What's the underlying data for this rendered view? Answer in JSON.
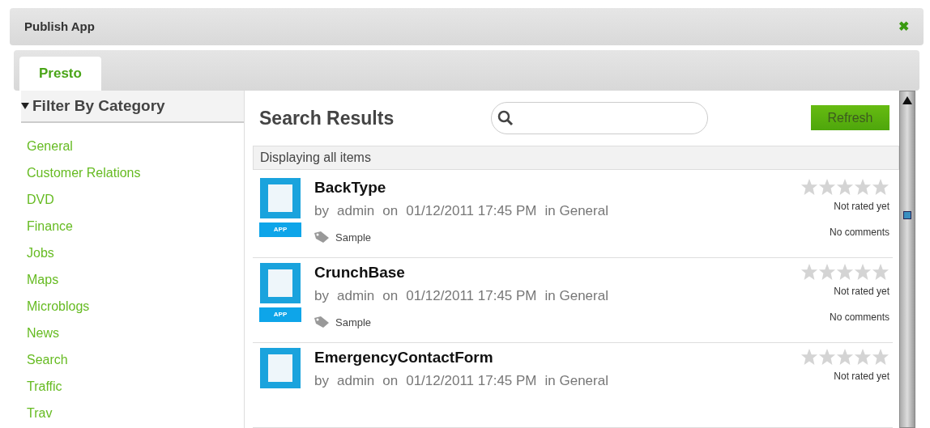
{
  "window": {
    "title": "Publish App",
    "close": "✖"
  },
  "tabs": [
    {
      "label": "Presto",
      "selected": true
    }
  ],
  "sidebar": {
    "heading": "Filter By Category",
    "expanded": true,
    "items": [
      "General",
      "Customer Relations",
      "DVD",
      "Finance",
      "Jobs",
      "Maps",
      "Microblogs",
      "News",
      "Search",
      "Traffic",
      "Trav"
    ]
  },
  "main": {
    "title": "Search Results",
    "refresh_button": "Refresh",
    "status": "Displaying all items",
    "results": [
      {
        "name": "BackType",
        "meta": [
          "by",
          "admin",
          "on",
          "01/12/2011 17:45 PM",
          "in General"
        ],
        "badge": "APP",
        "tag": "Sample",
        "stars": 0,
        "rating": "Not rated yet",
        "comments": "No comments"
      },
      {
        "name": "CrunchBase",
        "meta": [
          "by",
          "admin",
          "on",
          "01/12/2011 17:45 PM",
          "in General"
        ],
        "badge": "APP",
        "tag": "Sample",
        "stars": 0,
        "rating": "Not rated yet",
        "comments": "No comments"
      },
      {
        "name": "EmergencyContactForm",
        "meta": [
          "by",
          "admin",
          "on",
          "01/12/2011 17:45 PM",
          "in General"
        ],
        "stars": 0,
        "rating": "Not rated yet"
      }
    ]
  }
}
